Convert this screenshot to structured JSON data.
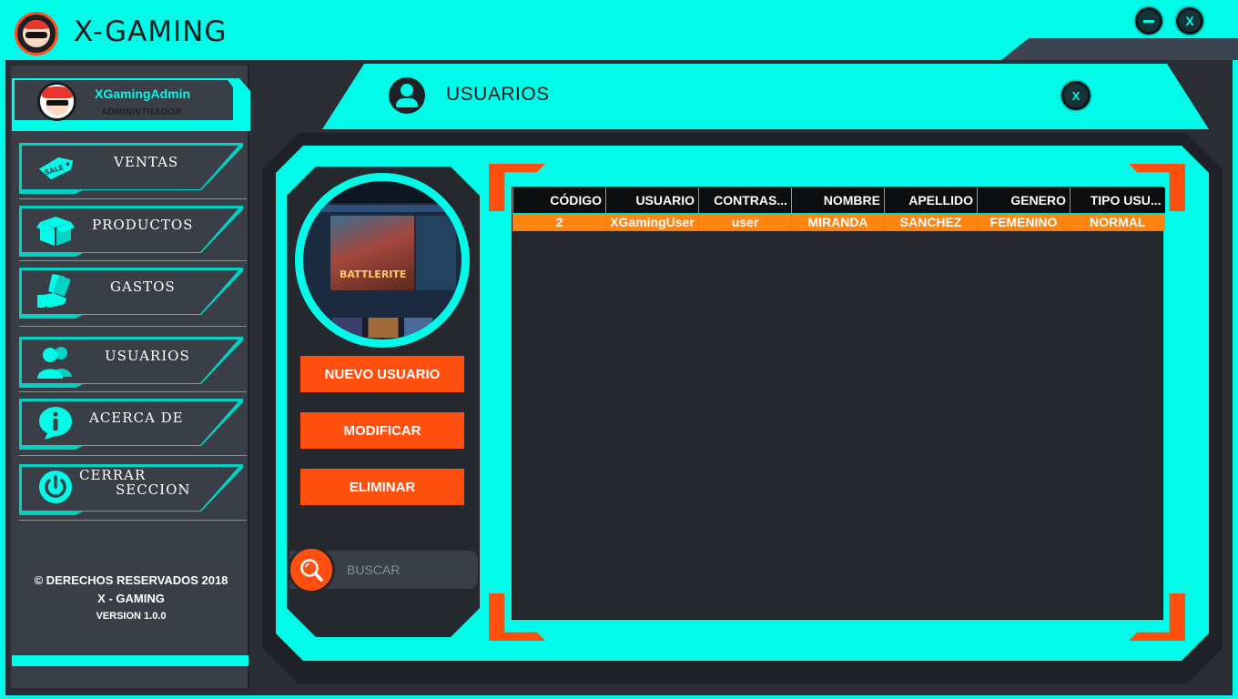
{
  "app": {
    "title": "X-GAMING"
  },
  "window": {
    "minimize_label": "",
    "close_label": "X"
  },
  "profile": {
    "username": "XGamingAdmin",
    "role": "ADMINISTRADOR"
  },
  "sidebar": {
    "items": [
      {
        "label": "VENTAS",
        "icon": "sale-tag-icon"
      },
      {
        "label": "PRODUCTOS",
        "icon": "box-icon"
      },
      {
        "label": "GASTOS",
        "icon": "money-hand-icon"
      },
      {
        "label": "USUARIOS",
        "icon": "users-icon"
      },
      {
        "label": "ACERCA DE",
        "icon": "info-icon"
      },
      {
        "label_line1": "CERRAR",
        "label_line2": "SECCION",
        "icon": "power-icon"
      }
    ],
    "footer": {
      "copyright": "© DERECHOS RESERVADOS 2018",
      "brand": "X - GAMING",
      "version": "VERSION 1.0.0"
    }
  },
  "header": {
    "title": "USUARIOS",
    "close_label": "X"
  },
  "actions": {
    "new_user": "NUEVO USUARIO",
    "edit": "MODIFICAR",
    "delete": "ELIMINAR"
  },
  "search": {
    "placeholder": "BUSCAR"
  },
  "photo": {
    "caption": "BATTLERITE"
  },
  "table": {
    "columns": [
      "CÓDIGO",
      "USUARIO",
      "CONTRAS...",
      "NOMBRE",
      "APELLIDO",
      "GENERO",
      "TIPO USU..."
    ],
    "rows": [
      [
        "2",
        "XGamingUser",
        "user",
        "MIRANDA",
        "SANCHEZ",
        "FEMENINO",
        "NORMAL"
      ]
    ]
  },
  "colors": {
    "accent": "#00fbe9",
    "orange": "#ff5010",
    "row_orange": "#ff8410",
    "panel": "#25282d"
  }
}
